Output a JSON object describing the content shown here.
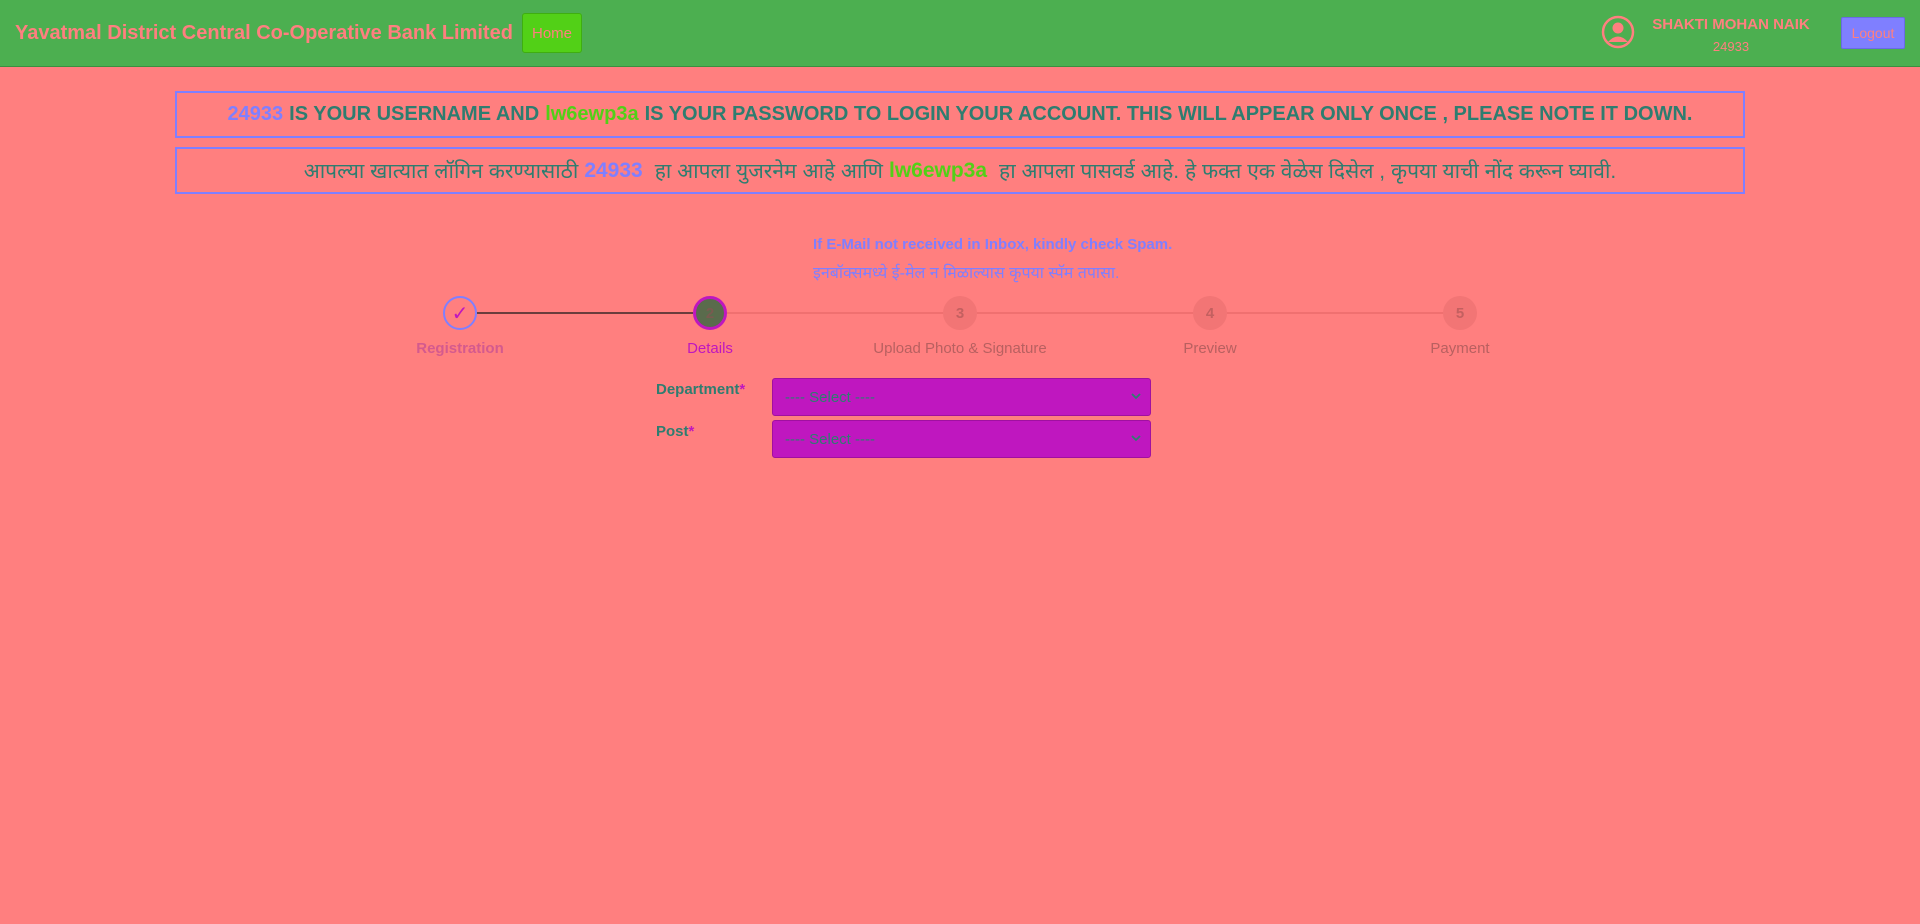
{
  "header": {
    "brand": "Yavatmal District Central Co-Operative Bank Limited",
    "home_label": "Home",
    "user_name": "SHAKTI MOHAN NAIK",
    "user_id": "24933",
    "logout_label": "Logout"
  },
  "notice_en": {
    "username": "24933",
    "text1": "IS YOUR USERNAME AND",
    "password": "lw6ewp3a",
    "text2": "IS YOUR PASSWORD TO LOGIN YOUR ACCOUNT. THIS WILL APPEAR ONLY ONCE , PLEASE NOTE IT DOWN."
  },
  "notice_mr": {
    "text1": "आपल्या खात्यात लॉगिन करण्यासाठी",
    "username": "24933",
    "text2": "हा आपला युजरनेम आहे आणि",
    "password": "lw6ewp3a",
    "text3": "हा आपला पासवर्ड आहे. हे फक्त एक वेळेस दिसेल , कृपया याची नोंद करून घ्यावी."
  },
  "spam_note": {
    "en": "If E-Mail not received in Inbox, kindly check Spam.",
    "mr": "इनबॉक्समध्ये ई-मेल न मिळाल्यास कृपया स्पॅम तपासा."
  },
  "steps": [
    {
      "number": "✓",
      "label": "Registration",
      "state": "done"
    },
    {
      "number": "2",
      "label": "Details",
      "state": "active"
    },
    {
      "number": "3",
      "label": "Upload Photo & Signature",
      "state": "todo"
    },
    {
      "number": "4",
      "label": "Preview",
      "state": "todo"
    },
    {
      "number": "5",
      "label": "Payment",
      "state": "todo"
    }
  ],
  "form": {
    "department_label": "Department",
    "department_value": "---- Select ----",
    "post_label": "Post",
    "post_value": "---- Select ----",
    "required_mark": "*"
  },
  "colors": {
    "background": "#ff7f7f",
    "header": "#4caf50",
    "accent_blue": "#7f7fff",
    "accent_green": "#52d017",
    "accent_magenta": "#bf17bf"
  }
}
